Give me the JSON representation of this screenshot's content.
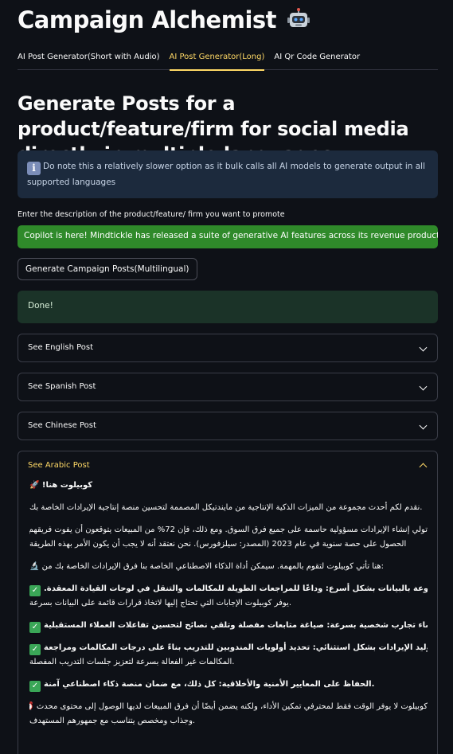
{
  "app": {
    "title": "Campaign Alchemist",
    "title_icon": "robot-icon"
  },
  "tabs": [
    {
      "label": "AI Post Generator(Short with Audio)",
      "active": false
    },
    {
      "label": "AI Post Generator(Long)",
      "active": true
    },
    {
      "label": "AI Qr Code Generator",
      "active": false
    }
  ],
  "main": {
    "headline": "Generate Posts for a product/feature/firm for social media directly in multiple languages",
    "info_icon": "info-icon",
    "info_text": "Do note this a relatively slower option as it bulk calls all AI models to generate output in all supported languages",
    "input_label": "Enter the description of the product/feature/ firm you want to promote",
    "input_value": "Copilot is here! Mindtickle has released a suite of generative AI features across its revenue productivity p",
    "generate_button": "Generate Campaign Posts(Multilingual)",
    "status": "Done!"
  },
  "expanders": [
    {
      "label": "See English Post",
      "expanded": false
    },
    {
      "label": "See Spanish Post",
      "expanded": false
    },
    {
      "label": "See Chinese Post",
      "expanded": false
    },
    {
      "label": "See Arabic Post",
      "expanded": true
    }
  ],
  "arabic_post": {
    "p1": "كوبيلوت هنا! 🚀",
    "p2": ".نقدم لكم أحدث مجموعة من الميزات الذكية الإنتاجية من مايندتيكل المصممة لتحسين منصة إنتاجية الإيرادات الخاصة بك",
    "p3a": "تولي إنشاء الإيرادات مسؤولية حاسمة على جميع فرق السوق. ومع ذلك، فإن 72% من المبيعات يتوقعون أن يفوت فريقهم 📈",
    "p3b": "الحصول على حصة سنوية في عام 2023 (المصدر: سيلزفورس). نحن نعتقد أنه لا يجب أن يكون الأمر بهذه الطريقة",
    "p4": ":هنا تأتي كوبيلوت لتقوم بالمهمة. سيمكن أداة الذكاء الاصطناعي الخاصة بنا فرق الإيرادات الخاصة بك من 🔬",
    "p5a": "اكتشاف رؤى مدفوعة بالبيانات بشكل أسرع: وداعًا للمراجعات الطويلة للمكالمات والتنقل في لوحات القيادة المعقدة.",
    "p5b": ".يوفر كوبيلوت الإجابات التي تحتاج إليها لاتخاذ قرارات قائمة على البيانات بسرعة",
    "p6": ".إنشاء تجارب شخصية بسرعة: صياغة متابعات مفصلة وتلقي نصائح لتحسين تفاعلات العملاء المستقبلية",
    "p7a": "تنفيذ تفاعلات توليد الإيرادات بشكل استثنائي: تحديد أولويات المندوبين للتدريب بناءً على درجات المكالمات ومراجعة",
    "p7b": ".المكالمات غير الفعالة بسرعة لتعزيز جلسات التدريب المفصلة",
    "p8": ".الحفاظ على المعايير الأمنية والأخلاقية: كل ذلك، مع ضمان منصة ذكاء اصطناعي آمنة",
    "p9a": "كوبيلوت لا يوفر الوقت فقط لمحترفي تمكين الأداء، ولكنه يضمن أيضًا أن فرق المبيعات لديها الوصول إلى محتوى محدث ⏰",
    "p9b": ".وجذاب ومخصص يتناسب مع جمهورهم المستهدف"
  }
}
